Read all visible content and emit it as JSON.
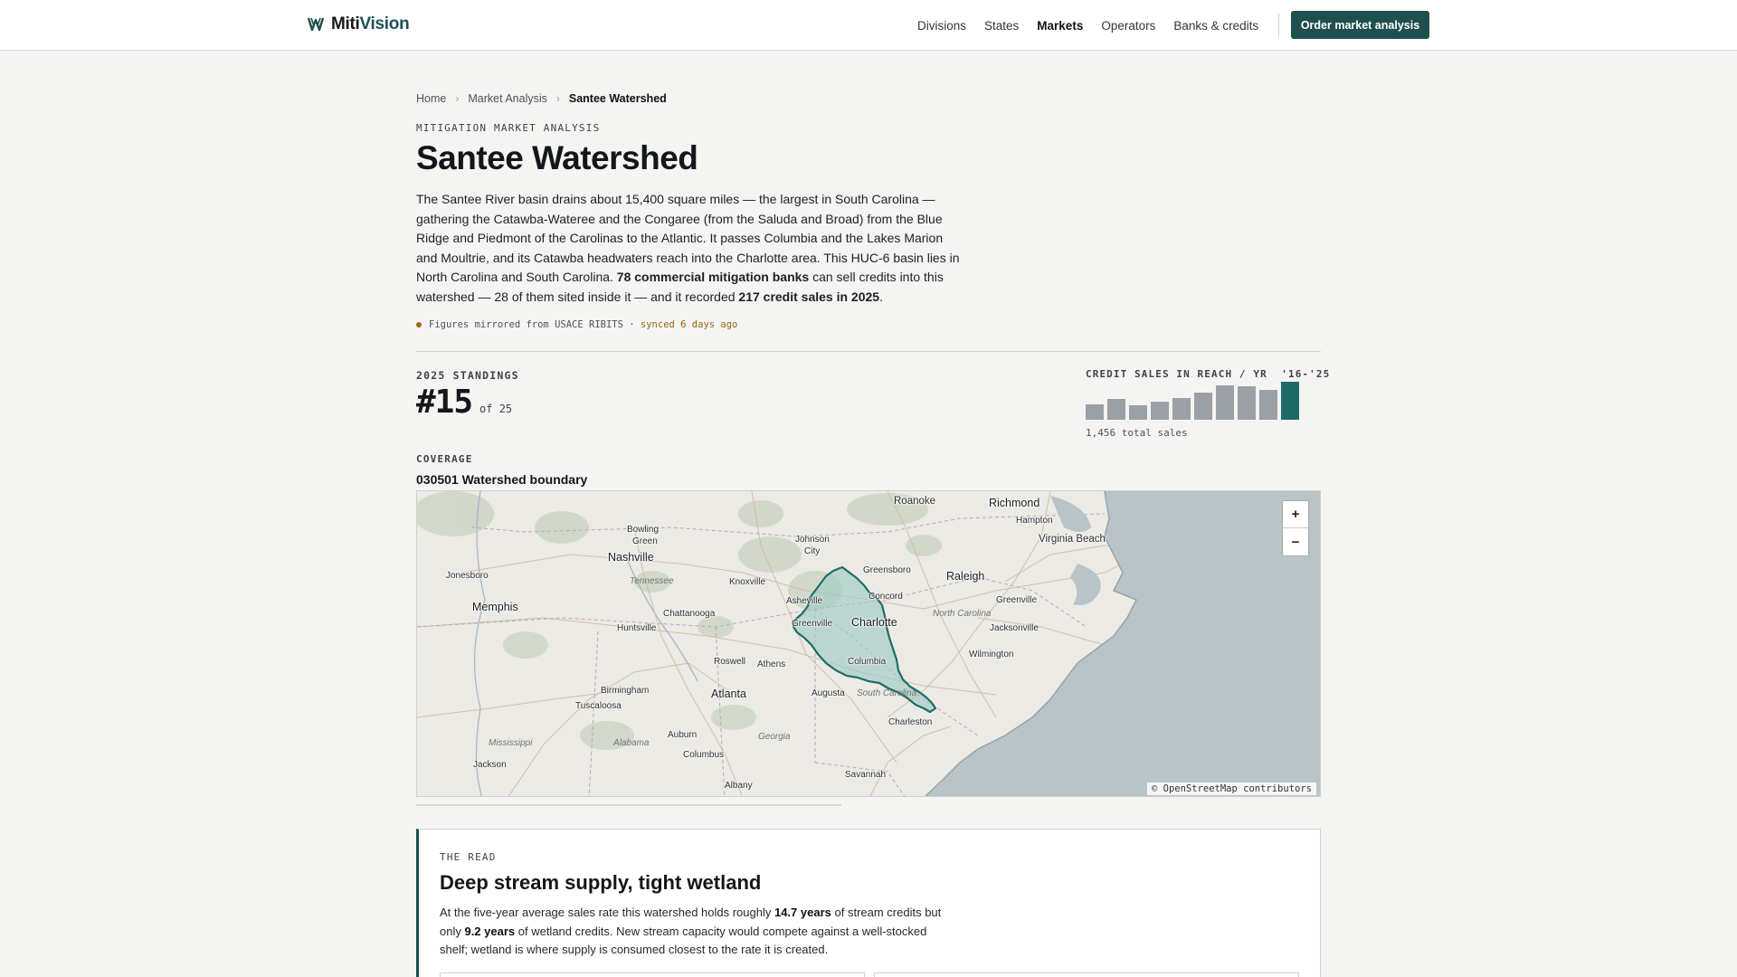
{
  "header": {
    "brand_a": "Miti",
    "brand_b": "Vision",
    "nav": [
      "Divisions",
      "States",
      "Markets",
      "Operators",
      "Banks & credits"
    ],
    "active_nav": "Markets",
    "cta": "Order market analysis"
  },
  "breadcrumbs": [
    "Home",
    "Market Analysis",
    "Santee Watershed"
  ],
  "eyebrow": "MITIGATION MARKET ANALYSIS",
  "title": "Santee Watershed",
  "intro": {
    "p1": "The Santee River basin drains about 15,400 square miles — the largest in South Carolina — gathering the Catawba-Wateree and the Congaree (from the Saluda and Broad) from the Blue Ridge and Piedmont of the Carolinas to the Atlantic. It passes Columbia and the Lakes Marion and Moultrie, and its Catawba headwaters reach into the Charlotte area. This HUC-6 basin lies in North Carolina and South Carolina. ",
    "banks_strong": "78 commercial mitigation banks",
    "p2": " can sell credits into this watershed — 28 of them sited inside it — and it recorded ",
    "sales_strong": "217 credit sales in 2025",
    "p3": "."
  },
  "sync": {
    "text": "Figures mirrored from USACE RIBITS ·",
    "ago": "synced 6 days ago"
  },
  "standings": {
    "label": "2025 STANDINGS",
    "rank": "#15",
    "of": "of 25"
  },
  "sparkline": {
    "label": "CREDIT SALES IN REACH / YR",
    "range": "'16-'25",
    "total": "1,456 total sales",
    "values": [
      90,
      118,
      84,
      102,
      125,
      155,
      198,
      190,
      173,
      218
    ],
    "colors": {
      "bar": "#9aa0a5",
      "highlight": "#1c6b68"
    }
  },
  "coverage": {
    "label": "COVERAGE",
    "code": "030501",
    "title": "Watershed boundary"
  },
  "map": {
    "attribution": "© OpenStreetMap contributors",
    "zoom_in": "+",
    "zoom_out": "−",
    "colors": {
      "water": "#b9c4c8",
      "land": "#eceae4",
      "basin": "#1f6d67"
    },
    "cities": {
      "roanoke": "Roanoke",
      "richmond": "Richmond",
      "hampton": "Hampton",
      "virginia_beach": "Virginia Beach",
      "bowling_green_1": "Bowling",
      "bowling_green_2": "Green",
      "johnson_1": "Johnson",
      "johnson_2": "City",
      "greensboro": "Greensboro",
      "raleigh": "Raleigh",
      "nashville": "Nashville",
      "jonesboro": "Jonesboro",
      "tennessee": "Tennessee",
      "knoxville": "Knoxville",
      "asheville": "Asheville",
      "concord": "Concord",
      "greenville_nc": "Greenville",
      "memphis": "Memphis",
      "chattanooga": "Chattanooga",
      "north_carolina": "North Carolina",
      "greenville_sc": "Greenville",
      "charlotte": "Charlotte",
      "huntsville": "Huntsville",
      "jacksonville": "Jacksonville",
      "wilmington": "Wilmington",
      "roswell": "Roswell",
      "athens": "Athens",
      "columbia": "Columbia",
      "birmingham": "Birmingham",
      "atlanta": "Atlanta",
      "augusta": "Augusta",
      "south_carolina": "South Carolina",
      "tuscaloosa": "Tuscaloosa",
      "charleston": "Charleston",
      "auburn": "Auburn",
      "georgia": "Georgia",
      "mississippi": "Mississippi",
      "alabama": "Alabama",
      "columbus": "Columbus",
      "jackson": "Jackson",
      "albany": "Albany",
      "savannah": "Savannah"
    }
  },
  "read": {
    "eyebrow": "THE READ",
    "title": "Deep stream supply, tight wetland",
    "b1": "At the five-year average sales rate this watershed holds roughly ",
    "stream_years": "14.7 years",
    "b2": " of stream credits but only ",
    "wetland_years": "9.2 years",
    "b3": " of wetland credits. New stream capacity would compete against a well-stocked shelf; wetland is where supply is consumed closest to the rate it is created."
  }
}
